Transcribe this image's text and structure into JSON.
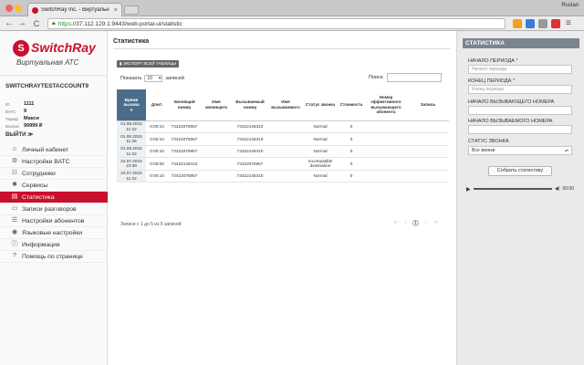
{
  "browser": {
    "tab_title": "SwitchRay Inc. - Виртуальн",
    "tab_close": "×",
    "user_name": "Ruslan",
    "url_scheme": "https",
    "url_rest": "://37.112.129.1:9443/web-portal-ui/statistic",
    "back": "←",
    "forward": "→",
    "reload": "C"
  },
  "brand": {
    "mark": "S",
    "name": "SwitchRay",
    "subtitle": "Виртуальная АТС"
  },
  "account": {
    "name": "SWITCHRAYTESTACCOUNT9",
    "fields": [
      {
        "key": "ID",
        "value": "1111"
      },
      {
        "key": "ВАТС",
        "value": "9"
      },
      {
        "key": "Тариф",
        "value": "Макси"
      },
      {
        "key": "Баланс",
        "value": "99999 ₽"
      }
    ],
    "logout": "ВЫЙТИ ≫"
  },
  "menu": [
    {
      "label": "Личный кабинет",
      "icon": "user-icon",
      "glyph": "☺",
      "active": false
    },
    {
      "label": "Настройки ВАТС",
      "icon": "settings-icon",
      "glyph": "⚙",
      "active": false
    },
    {
      "label": "Сотрудники",
      "icon": "employees-icon",
      "glyph": "☷",
      "active": false
    },
    {
      "label": "Сервисы",
      "icon": "services-icon",
      "glyph": "✱",
      "active": false
    },
    {
      "label": "Статистика",
      "icon": "statistics-icon",
      "glyph": "▤",
      "active": true
    },
    {
      "label": "Записи разговоров",
      "icon": "recordings-icon",
      "glyph": "▭",
      "active": false
    },
    {
      "label": "Настройки абонентов",
      "icon": "subscribers-icon",
      "glyph": "☰",
      "active": false
    },
    {
      "label": "Языковые настройки",
      "icon": "language-icon",
      "glyph": "◉",
      "active": false
    },
    {
      "label": "Информация",
      "icon": "info-icon",
      "glyph": "ⓘ",
      "active": false
    },
    {
      "label": "Помощь по странице",
      "icon": "help-icon",
      "glyph": "?",
      "active": false
    }
  ],
  "main": {
    "tab": "Статистика",
    "export_label": "ЭКСПОРТ ВСЕЙ ТАБЛИЦЫ",
    "show_prefix": "Показать",
    "show_value": "10",
    "show_suffix": "записей",
    "search_label": "Поиск:",
    "pagination_info": "Записи с 1 до 5 из 5 записей",
    "pager": [
      "«",
      "‹",
      "1",
      "›",
      "»"
    ],
    "columns": [
      "Время вызова",
      "Длит.",
      "Звонящий номер",
      "Имя звонящего",
      "Вызываемый номер",
      "Имя вызываемого",
      "Статус звонка",
      "Стоимость",
      "Номер эффективного вызывающего абонента",
      "Запись"
    ],
    "sort_glyph": "▾",
    "rows": [
      {
        "time": "01.08.2015 11:22",
        "dur": "0:00:10",
        "caller": "73422075957",
        "caller_name": "",
        "called": "73422146310",
        "called_name": "",
        "status": "Normal",
        "cost": "0",
        "effective": "",
        "record": ""
      },
      {
        "time": "01.08.2015 11:26",
        "dur": "0:00:10",
        "caller": "73422075957",
        "caller_name": "",
        "called": "73422146310",
        "called_name": "",
        "status": "Normal",
        "cost": "0",
        "effective": "",
        "record": ""
      },
      {
        "time": "01.08.2015 11:22",
        "dur": "0:00:10",
        "caller": "73422075957",
        "caller_name": "",
        "called": "73422146310",
        "called_name": "",
        "status": "Normal",
        "cost": "0",
        "effective": "",
        "record": ""
      },
      {
        "time": "24.07.2015 10:39",
        "dur": "0:00:00",
        "caller": "73422146310",
        "caller_name": "",
        "called": "73422075957",
        "called_name": "",
        "status": "Incompatible destination",
        "cost": "0",
        "effective": "",
        "record": ""
      },
      {
        "time": "24.07.2015 11:22",
        "dur": "0:00:10",
        "caller": "73422075957",
        "caller_name": "",
        "called": "73422146310",
        "called_name": "",
        "status": "Normal",
        "cost": "0",
        "effective": "",
        "record": ""
      }
    ]
  },
  "panel": {
    "title": "СТАТИСТИКА",
    "start_label": "НАЧАЛО ПЕРИОДА",
    "start_placeholder": "Начало периода",
    "end_label": "КОНЕЦ ПЕРИОДА",
    "end_placeholder": "Конец периода",
    "caller_start_label": "НАЧАЛО ВЫЗЫВАЮЩЕГО НОМЕРА",
    "called_start_label": "НАЧАЛО ВЫЗЫВАЕМОГО НОМЕРА",
    "status_label": "СТАТУС ЗВОНКА",
    "status_value": "Все звонки",
    "required_mark": "*",
    "button": "Собрать статистику",
    "player_play": "▶",
    "player_time": "00:00",
    "player_volume": "◀)"
  },
  "colors": {
    "brand_red": "#c8102e",
    "sorted_header": "#4a6d8c",
    "panel_head": "#7b8591"
  }
}
